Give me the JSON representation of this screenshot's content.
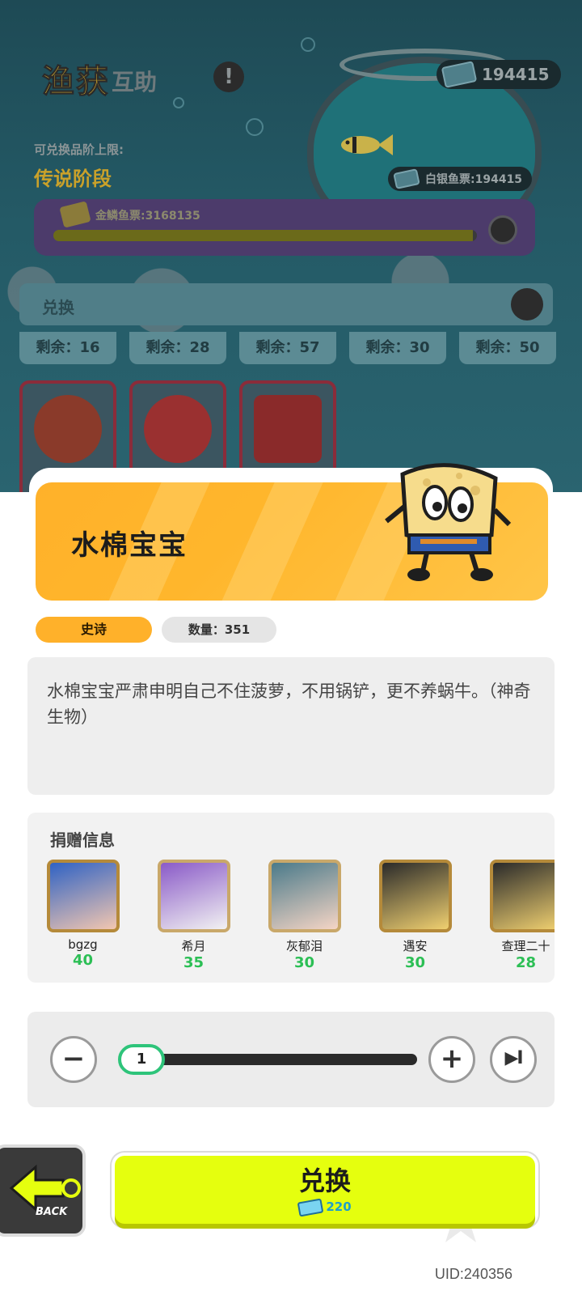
{
  "background": {
    "title_main": "渔获",
    "title_sub": "互助",
    "alert_glyph": "!",
    "ticket_top": "194415",
    "silver_ticket": "白银鱼票:194415",
    "tier_label": "可兑换品阶上限:",
    "tier_value": "传说阶段",
    "gold_ticket": "金鳞鱼票:3168135",
    "gold_progress": 0.99,
    "exchange_label": "兑换",
    "remaining": [
      "剩余：16",
      "剩余：28",
      "剩余：57",
      "剩余：30",
      "剩余：50"
    ]
  },
  "item": {
    "name": "水棉宝宝",
    "rarity": "史诗",
    "quantity": "数量：351",
    "description": "水棉宝宝严肃申明自己不住菠萝，不用锅铲，更不养蜗牛。（神奇生物）"
  },
  "donations": {
    "heading": "捐赠信息",
    "donors": [
      {
        "name": "bgzg",
        "amount": "40"
      },
      {
        "name": "希月",
        "amount": "35"
      },
      {
        "name": "灰郁泪",
        "amount": "30"
      },
      {
        "name": "遇安",
        "amount": "30"
      },
      {
        "name": "查理二十",
        "amount": "28"
      }
    ]
  },
  "quantity_selector": {
    "value": "1",
    "minus": "−",
    "plus": "+",
    "max": "▶I"
  },
  "actions": {
    "back_label": "BACK",
    "exchange_label": "兑换",
    "exchange_cost": "220"
  },
  "footer": {
    "uid": "UID:240356"
  },
  "colors": {
    "accent_orange": "#ffb12a",
    "exchange_yellow": "#e5ff0e",
    "donation_green": "#2cbf55",
    "slider_green": "#2ec47a"
  }
}
